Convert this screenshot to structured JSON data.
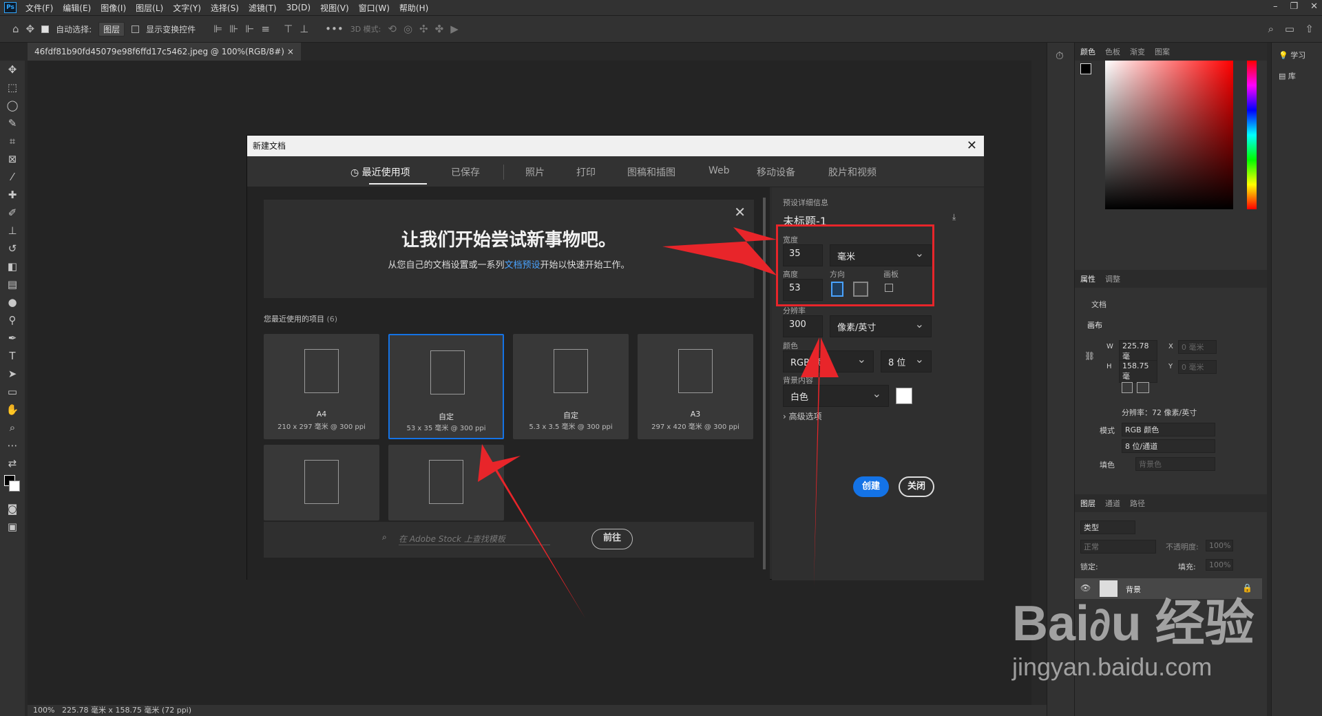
{
  "app": {
    "logo": "Ps"
  },
  "menu": [
    "文件(F)",
    "编辑(E)",
    "图像(I)",
    "图层(L)",
    "文字(Y)",
    "选择(S)",
    "滤镜(T)",
    "3D(D)",
    "视图(V)",
    "窗口(W)",
    "帮助(H)"
  ],
  "options": {
    "auto_select_label": "自动选择:",
    "auto_select_value": "图层",
    "show_transform_label": "显示变换控件",
    "mode3d_label": "3D 模式:"
  },
  "document_tab": "46fdf81b90fd45079e98f6ffd17c5462.jpeg @ 100%(RGB/8#)",
  "status": {
    "zoom": "100%",
    "size": "225.78 毫米 x 158.75 毫米 (72 ppi)"
  },
  "panels": {
    "color_tabs": [
      "颜色",
      "色板",
      "渐变",
      "图案"
    ],
    "props_tabs": [
      "属性",
      "调整"
    ],
    "props_doc": "文档",
    "canvas_label": "画布",
    "w_label": "W",
    "w_value": "225.78 毫",
    "h_label": "H",
    "h_value": "158.75 毫",
    "x_label": "X",
    "x_placeholder": "0 毫米",
    "y_label": "Y",
    "y_placeholder": "0 毫米",
    "resolution": "分辨率：72 像素/英寸",
    "mode_label": "模式",
    "mode_value": "RGB 颜色",
    "bits_value": "8 位/通道",
    "fill_label": "填色",
    "fill_value": "背景色",
    "layers_tabs": [
      "图层",
      "通道",
      "路径"
    ],
    "layer_kind": "类型",
    "blend_mode": "正常",
    "opacity_label": "不透明度:",
    "opacity_value": "100%",
    "lock_label": "锁定:",
    "fill2_label": "填充:",
    "fill2_value": "100%",
    "layer_name": "背景",
    "learn": "学习",
    "library": "库"
  },
  "dialog": {
    "title": "新建文档",
    "tabs": [
      "最近使用项",
      "已保存",
      "照片",
      "打印",
      "图稿和插图",
      "Web",
      "移动设备",
      "胶片和视频"
    ],
    "banner_title": "让我们开始尝试新事物吧。",
    "banner_text_a": "从您自己的文档设置或一系列",
    "banner_link": "文档预设",
    "banner_text_b": "开始以快速开始工作。",
    "recent_label": "您最近使用的项目",
    "recent_count": "(6)",
    "cards": [
      {
        "name": "A4",
        "spec": "210 x 297 毫米 @ 300 ppi"
      },
      {
        "name": "自定",
        "spec": "53 x 35 毫米 @ 300 ppi"
      },
      {
        "name": "自定",
        "spec": "5.3 x 3.5 毫米 @ 300 ppi"
      },
      {
        "name": "A3",
        "spec": "297 x 420 毫米 @ 300 ppi"
      }
    ],
    "stock_placeholder": "在 Adobe Stock 上查找模板",
    "go_button": "前往",
    "preset_details": "预设详细信息",
    "doc_name": "未标题-1",
    "width_label": "宽度",
    "width_value": "35",
    "width_unit": "毫米",
    "height_label": "高度",
    "height_value": "53",
    "orientation_label": "方向",
    "artboard_label": "画板",
    "resolution_label": "分辨率",
    "resolution_value": "300",
    "resolution_unit": "像素/英寸",
    "color_mode_label": "颜色",
    "color_mode_value": "RGB 颜色",
    "bit_depth": "8 位",
    "bg_label": "背景内容",
    "bg_value": "白色",
    "advanced": "高级选项",
    "create": "创建",
    "close": "关闭"
  },
  "colors": {
    "accent": "#1473e6",
    "highlight": "#e8252a",
    "link": "#4aa3ff"
  }
}
